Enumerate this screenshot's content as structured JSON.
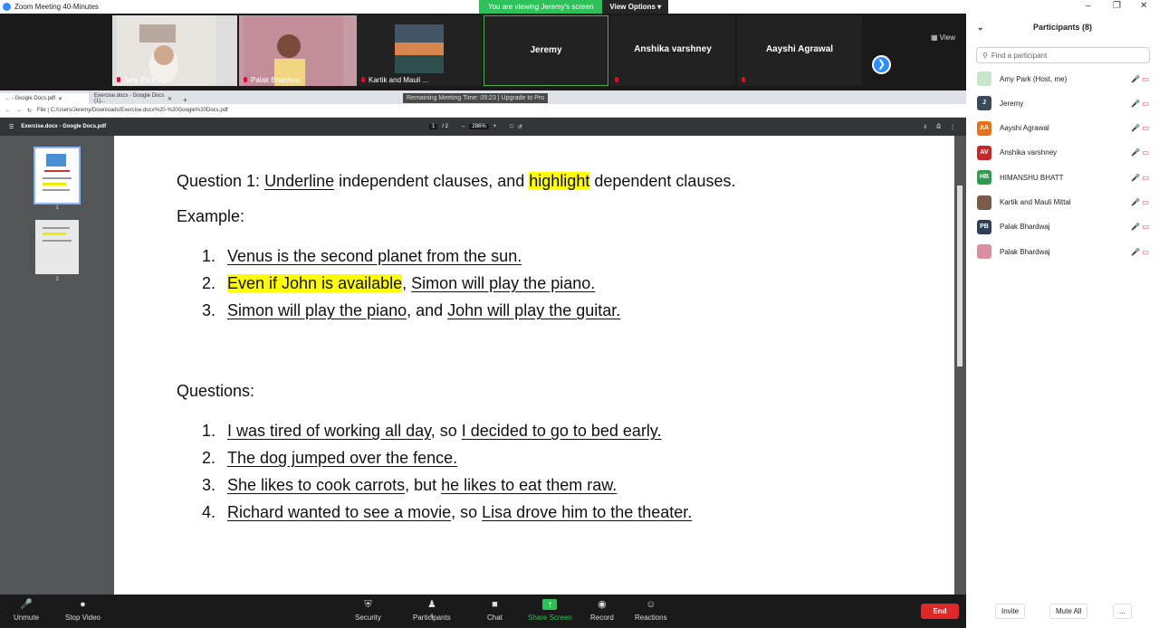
{
  "window": {
    "title": "Zoom Meeting 40-Minutes"
  },
  "banner": {
    "viewing": "You are viewing Jeremy's screen",
    "view_options": "View Options"
  },
  "gallery": {
    "tiles": [
      {
        "name": "Amy Park"
      },
      {
        "name": "Palak  Bhardwa"
      },
      {
        "name": "Kartik and Mauli ..."
      },
      {
        "name": "Jeremy"
      },
      {
        "name": "Anshika varshney"
      },
      {
        "name": "Aayshi Agrawal"
      }
    ],
    "view_label": "View"
  },
  "remaining": "Remaining Meeting Time: 05:23 | Upgrade to Pro",
  "browser": {
    "tabs": [
      "... - Google Docs.pdf",
      "Exercise.docx - Google Docs (1)..."
    ],
    "address": "File  |  C:/Users/Jeremy/Downloads/Exercise.docx%20-%20Google%20Docs.pdf",
    "pdf_title": "Exercise.docx - Google Docs.pdf",
    "page_current": "1",
    "page_total": "/ 2",
    "zoom": "286%",
    "thumb_nums": [
      "1",
      "2"
    ]
  },
  "doc": {
    "q1_parts": [
      "Question 1: ",
      "Underline",
      " independent clauses, and ",
      "highlight",
      " dependent clauses."
    ],
    "example_label": "Example:",
    "example_items": [
      {
        "n": "1.",
        "parts": [
          {
            "t": "Venus is the second planet from the sun.",
            "s": "u"
          }
        ]
      },
      {
        "n": "2.",
        "parts": [
          {
            "t": "Even if John is available",
            "s": "hl"
          },
          {
            "t": ", ",
            "s": ""
          },
          {
            "t": "Simon will play the piano.",
            "s": "u"
          }
        ]
      },
      {
        "n": "3.",
        "parts": [
          {
            "t": "Simon will play the piano",
            "s": "u"
          },
          {
            "t": ", and ",
            "s": ""
          },
          {
            "t": "John will play the guitar.",
            "s": "u"
          }
        ]
      }
    ],
    "questions_label": "Questions:",
    "question_items": [
      {
        "n": "1.",
        "parts": [
          {
            "t": "I was tired of working all day",
            "s": "u"
          },
          {
            "t": ", so ",
            "s": ""
          },
          {
            "t": "I decided to go to bed early.",
            "s": "u"
          }
        ]
      },
      {
        "n": "2.",
        "parts": [
          {
            "t": "The dog jumped over the fence.",
            "s": "u"
          }
        ]
      },
      {
        "n": "3.",
        "parts": [
          {
            "t": "She likes to cook carrots",
            "s": "u"
          },
          {
            "t": ", but ",
            "s": ""
          },
          {
            "t": "he likes to eat them raw.",
            "s": "u"
          }
        ]
      },
      {
        "n": "4.",
        "parts": [
          {
            "t": "Richard wanted to see a movie",
            "s": "u"
          },
          {
            "t": ", so ",
            "s": ""
          },
          {
            "t": "Lisa drove him to the theater.",
            "s": "u"
          }
        ]
      }
    ]
  },
  "toolbar": {
    "unmute": "Unmute",
    "stop_video": "Stop Video",
    "security": "Security",
    "participants": "Participants",
    "participants_count": "8",
    "chat": "Chat",
    "share": "Share Screen",
    "record": "Record",
    "reactions": "Reactions",
    "end": "End"
  },
  "panel": {
    "title": "Participants (8)",
    "search_placeholder": "Find a participant",
    "participants": [
      {
        "name": "Amy Park (Host, me)",
        "initials": "",
        "color": "#c8e6c9"
      },
      {
        "name": "Jeremy",
        "initials": "J",
        "color": "#3b4a5a"
      },
      {
        "name": "Aayshi Agrawal",
        "initials": "AA",
        "color": "#e8711c"
      },
      {
        "name": "Anshika varshney",
        "initials": "AV",
        "color": "#c62828"
      },
      {
        "name": "HIMANSHU BHATT",
        "initials": "HB",
        "color": "#2e9b4e"
      },
      {
        "name": "Kartik and Mauli Mittal",
        "initials": "",
        "color": "#7a5a48"
      },
      {
        "name": "Palak  Bhardwaj",
        "initials": "PB",
        "color": "#2f3f55"
      },
      {
        "name": "Palak Bhardwaj",
        "initials": "",
        "color": "#d98fa0"
      }
    ],
    "invite": "Invite",
    "mute_all": "Mute All",
    "more": "..."
  }
}
